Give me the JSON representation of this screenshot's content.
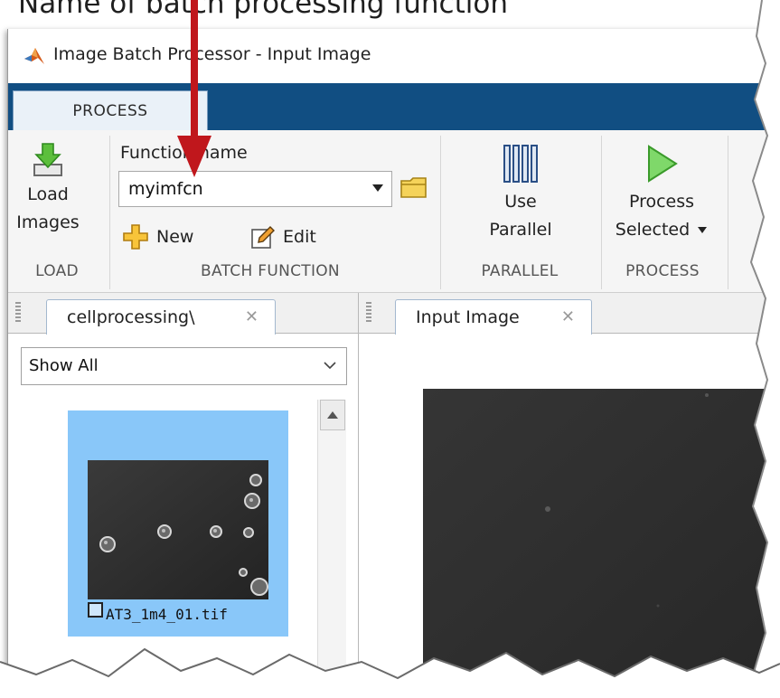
{
  "caption": "Name of batch processing function",
  "window": {
    "title": "Image Batch Processor - Input Image"
  },
  "ribbon": {
    "tabs": [
      {
        "label": "PROCESS",
        "selected": true
      }
    ],
    "load": {
      "button_line1": "Load",
      "button_line2": "Images",
      "group_label": "LOAD"
    },
    "batch_function": {
      "field_label": "Function name",
      "function_value": "myimfcn",
      "new_label": "New",
      "edit_label": "Edit",
      "group_label": "BATCH FUNCTION"
    },
    "parallel": {
      "button_line1": "Use",
      "button_line2": "Parallel",
      "group_label": "PARALLEL"
    },
    "process": {
      "button_line1": "Process",
      "button_line2": "Selected",
      "group_label": "PROCESS"
    }
  },
  "browser": {
    "tab_label": "cellprocessing\\",
    "filter_value": "Show All",
    "thumbnails": [
      {
        "filename": "AT3_1m4_01.tif",
        "selected": true,
        "checked": false
      }
    ]
  },
  "viewer": {
    "tab_label": "Input Image"
  },
  "colors": {
    "ribbon_tabstrip": "#114e82",
    "selected_thumbnail": "#89c7f9",
    "annotation_arrow": "#c0171c",
    "matlab_logo": "#d55a1a"
  },
  "icons": {
    "app": "matlab-logo-icon",
    "load": "download-icon",
    "folder": "folder-icon",
    "new": "plus-icon",
    "edit": "pencil-icon",
    "parallel": "parallel-bars-icon",
    "process": "play-icon",
    "close": "close-icon"
  }
}
